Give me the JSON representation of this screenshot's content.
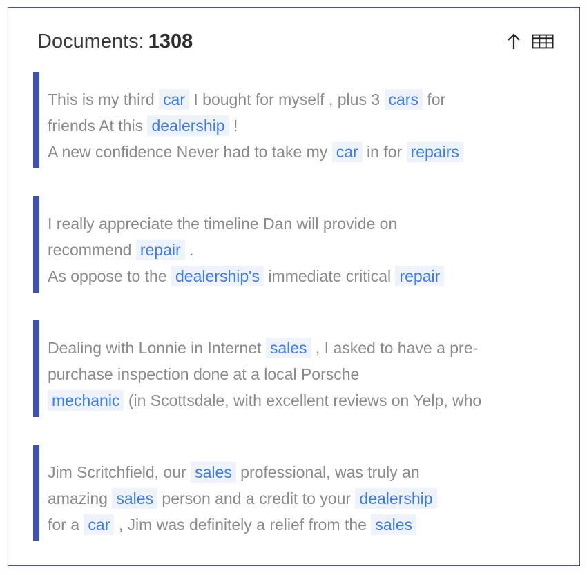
{
  "header": {
    "label": "Documents:",
    "count": "1308",
    "sort_icon": "arrow-up-icon",
    "table_icon": "table-icon"
  },
  "colors": {
    "accent": "#3f51b5",
    "highlight_bg": "#eef3fb",
    "highlight_text": "#3d7ce8",
    "body_text": "#8a8a8a"
  },
  "documents": [
    {
      "lines": [
        [
          {
            "t": "This is my third "
          },
          {
            "t": "car",
            "hl": true
          },
          {
            "t": " I bought for myself , plus 3 "
          },
          {
            "t": "cars",
            "hl": true
          },
          {
            "t": " for"
          }
        ],
        [
          {
            "t": "friends At this "
          },
          {
            "t": "dealership",
            "hl": true
          },
          {
            "t": " !"
          }
        ],
        [
          {
            "t": "A new confidence Never had to take my "
          },
          {
            "t": "car",
            "hl": true
          },
          {
            "t": " in for "
          },
          {
            "t": "repairs",
            "hl": true
          }
        ]
      ]
    },
    {
      "lines": [
        [
          {
            "t": "I really appreciate the timeline Dan will provide on"
          }
        ],
        [
          {
            "t": "recommend "
          },
          {
            "t": "repair",
            "hl": true
          },
          {
            "t": " ."
          }
        ],
        [
          {
            "t": "As oppose to the "
          },
          {
            "t": "dealership's",
            "hl": true
          },
          {
            "t": " immediate critical "
          },
          {
            "t": "repair",
            "hl": true
          }
        ]
      ]
    },
    {
      "lines": [
        [
          {
            "t": "Dealing with Lonnie in Internet "
          },
          {
            "t": "sales",
            "hl": true
          },
          {
            "t": " , I asked to have a pre-"
          }
        ],
        [
          {
            "t": "purchase inspection done at a local Porsche"
          }
        ],
        [
          {
            "t": "mechanic",
            "hl": true
          },
          {
            "t": " (in Scottsdale, with excellent reviews on Yelp, who"
          }
        ]
      ]
    },
    {
      "lines": [
        [
          {
            "t": "Jim Scritchfield, our "
          },
          {
            "t": "sales",
            "hl": true
          },
          {
            "t": " professional, was truly an"
          }
        ],
        [
          {
            "t": "amazing "
          },
          {
            "t": "sales",
            "hl": true
          },
          {
            "t": " person and a credit to your "
          },
          {
            "t": "dealership",
            "hl": true
          }
        ],
        [
          {
            "t": "for a "
          },
          {
            "t": "car",
            "hl": true
          },
          {
            "t": " , Jim was definitely a relief from the "
          },
          {
            "t": "sales",
            "hl": true
          }
        ]
      ]
    }
  ]
}
